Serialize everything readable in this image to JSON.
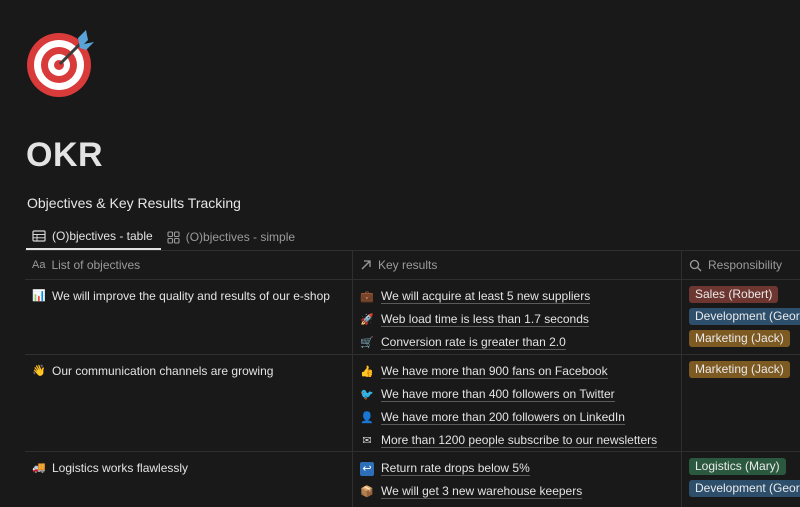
{
  "page": {
    "title": "OKR",
    "icon": "target-dart-icon"
  },
  "database": {
    "title": "Objectives & Key Results Tracking"
  },
  "tabs": [
    {
      "label": "(O)bjectives - table",
      "icon": "table-icon",
      "active": true
    },
    {
      "label": "(O)bjectives - simple",
      "icon": "gallery-icon",
      "active": false
    }
  ],
  "columns": [
    {
      "label": "List of objectives",
      "icon": "text-icon"
    },
    {
      "label": "Key results",
      "icon": "relation-arrow-icon"
    },
    {
      "label": "Responsibility",
      "icon": "search-icon"
    }
  ],
  "rows": [
    {
      "objective": "We will improve the quality and results of our e-shop",
      "objective_icon": "📊",
      "key_results": [
        {
          "icon": "💼",
          "text": "We will acquire at least 5 new suppliers"
        },
        {
          "icon": "🚀",
          "text": "Web load time is less than 1.7 seconds"
        },
        {
          "icon": "🛒",
          "text": "Conversion rate is greater than 2.0"
        }
      ],
      "responsibility": [
        {
          "label": "Sales (Robert)",
          "color": "#6e3630"
        },
        {
          "label": "Development (George)",
          "color": "#2d4f6c"
        },
        {
          "label": "Marketing (Jack)",
          "color": "#7e5a23"
        }
      ]
    },
    {
      "objective": "Our communication channels are growing",
      "objective_icon": "👋",
      "key_results": [
        {
          "icon": "👍",
          "text": "We have more than 900 fans on Facebook"
        },
        {
          "icon": "🐦",
          "text": "We have more than 400 followers on Twitter"
        },
        {
          "icon": "👤",
          "text": "We have more than 200 followers on LinkedIn"
        },
        {
          "icon": "✉",
          "text": "More than 1200 people subscribe to our newsletters"
        }
      ],
      "responsibility": [
        {
          "label": "Marketing (Jack)",
          "color": "#7e5a23"
        }
      ]
    },
    {
      "objective": "Logistics works flawlessly",
      "objective_icon": "🚚",
      "key_results": [
        {
          "icon": "↩",
          "text": "Return rate drops below 5%"
        },
        {
          "icon": "📦",
          "text": "We will get 3 new warehouse keepers"
        }
      ],
      "responsibility": [
        {
          "label": "Logistics (Mary)",
          "color": "#2b593f"
        },
        {
          "label": "Development (George)",
          "color": "#2d4f6c"
        }
      ]
    }
  ]
}
